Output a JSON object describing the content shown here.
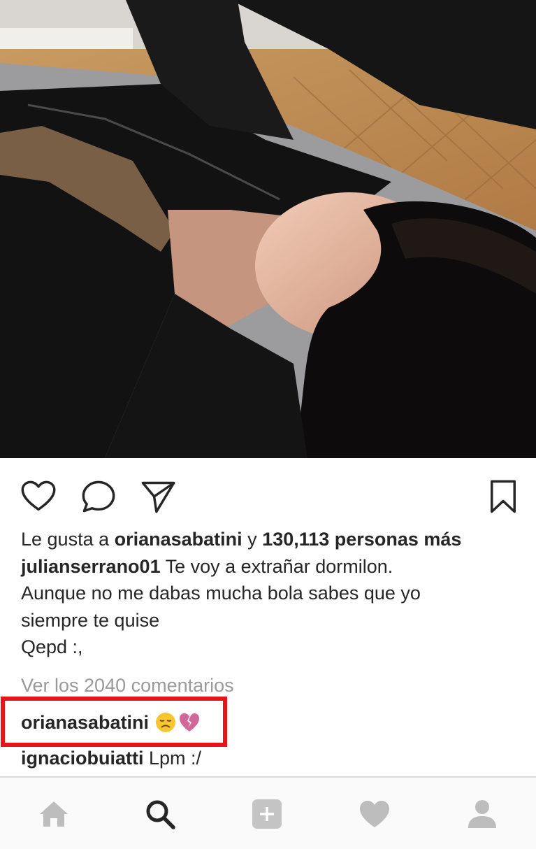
{
  "post": {
    "image_icon": "photo-person-lying-on-rug",
    "likes": {
      "prefix": "Le gusta a ",
      "user": "orianasabatini",
      "middle": " y ",
      "count_text": "130,113 personas más"
    },
    "caption": {
      "user": "julianserrano01",
      "line1": " Te voy a extrañar dormilon.",
      "line2": "Aunque no me dabas mucha bola sabes que yo",
      "line3": "siempre te quise",
      "line4": "Qepd :,"
    },
    "view_all_comments": "Ver los 2040 comentarios",
    "comments": [
      {
        "user": "orianasabatini",
        "text": "",
        "emojis": [
          "disappointed-face-emoji",
          "broken-heart-emoji"
        ]
      },
      {
        "user": "ignaciobuiatti",
        "text": " Lpm :/"
      }
    ]
  },
  "actions": {
    "like_icon": "heart-outline-icon",
    "comment_icon": "speech-bubble-icon",
    "share_icon": "paper-plane-icon",
    "save_icon": "bookmark-icon"
  },
  "bottom_nav": {
    "items": [
      "home-icon",
      "search-icon",
      "add-icon",
      "activity-heart-icon",
      "profile-icon"
    ]
  },
  "colors": {
    "highlight_border": "#e8141c",
    "text": "#262626",
    "muted": "#999999",
    "nav_inactive": "#bdbdbd",
    "nav_active": "#262626"
  }
}
